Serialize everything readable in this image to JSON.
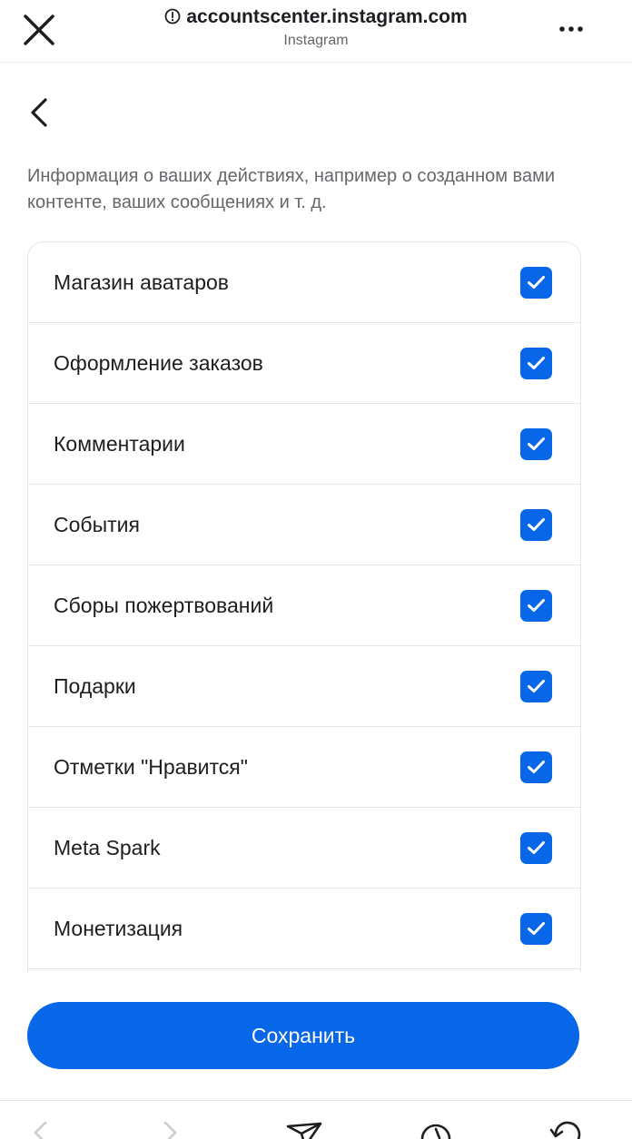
{
  "browser": {
    "url": "accountscenter.instagram.com",
    "site_name": "Instagram",
    "icons": {
      "close": "close-icon",
      "info": "info-icon",
      "more": "more-icon"
    }
  },
  "page": {
    "back_icon": "chevron-left-icon",
    "description": "Информация о ваших действиях, например о созданном вами контенте, ваших сообщениях и т. д.",
    "accent_color": "#0866e8",
    "items": [
      {
        "label": "Магазин аватаров",
        "checked": true
      },
      {
        "label": "Оформление заказов",
        "checked": true
      },
      {
        "label": "Комментарии",
        "checked": true
      },
      {
        "label": "События",
        "checked": true
      },
      {
        "label": "Сборы пожертвований",
        "checked": true
      },
      {
        "label": "Подарки",
        "checked": true
      },
      {
        "label": "Отметки \"Нравится\"",
        "checked": true
      },
      {
        "label": "Meta Spark",
        "checked": true
      },
      {
        "label": "Монетизация",
        "checked": true
      }
    ],
    "save_label": "Сохранить"
  },
  "toolbar": {
    "icons": [
      "back-icon",
      "forward-icon",
      "share-icon",
      "compass-icon",
      "reload-icon"
    ]
  }
}
